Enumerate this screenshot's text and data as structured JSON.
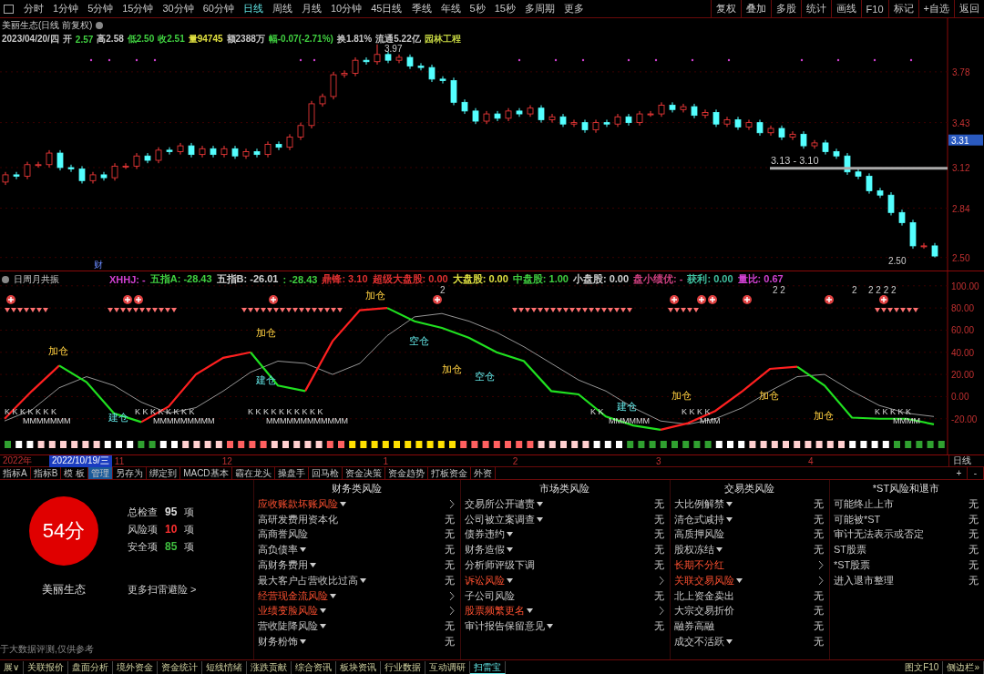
{
  "toolbar": {
    "periods": [
      {
        "label": "分时",
        "selected": false
      },
      {
        "label": "1分钟",
        "selected": false
      },
      {
        "label": "5分钟",
        "selected": false
      },
      {
        "label": "15分钟",
        "selected": false
      },
      {
        "label": "30分钟",
        "selected": false
      },
      {
        "label": "60分钟",
        "selected": false
      },
      {
        "label": "日线",
        "selected": true
      },
      {
        "label": "周线",
        "selected": false
      },
      {
        "label": "月线",
        "selected": false
      },
      {
        "label": "10分钟",
        "selected": false
      },
      {
        "label": "45日线",
        "selected": false
      },
      {
        "label": "季线",
        "selected": false
      },
      {
        "label": "年线",
        "selected": false
      },
      {
        "label": "5秒",
        "selected": false
      },
      {
        "label": "15秒",
        "selected": false
      },
      {
        "label": "多周期",
        "selected": false
      },
      {
        "label": "更多",
        "selected": false
      }
    ],
    "tools": [
      "复权",
      "叠加",
      "多股",
      "统计",
      "画线",
      "F10",
      "标记",
      "+自选",
      "返回"
    ]
  },
  "price_chart": {
    "title": "美丽生态(日线 前复权)",
    "quote": [
      {
        "text": "2023/04/20/四",
        "color": "#c8c8c8"
      },
      {
        "text": "开",
        "color": "#c8c8c8"
      },
      {
        "text": "2.57",
        "color": "#40d040"
      },
      {
        "text": "高2.58",
        "color": "#c8c8c8"
      },
      {
        "text": "低2.50",
        "color": "#40d040"
      },
      {
        "text": "收2.51",
        "color": "#40d040"
      },
      {
        "text": "量94745",
        "color": "#e0e040"
      },
      {
        "text": "额2388万",
        "color": "#c8c8c8"
      },
      {
        "text": "幅-0.07(-2.71%)",
        "color": "#40d040"
      },
      {
        "text": "换1.81%",
        "color": "#c8c8c8"
      },
      {
        "text": "流通5.22亿",
        "color": "#c8c8c8"
      },
      {
        "text": "园林工程",
        "color": "#c0d040"
      }
    ],
    "chart_data": {
      "type": "candlestick",
      "grid": true,
      "ylim": [
        2.41,
        4.15
      ],
      "yticks": [
        {
          "value": 3.78,
          "label": "3.78"
        },
        {
          "value": 3.43,
          "label": "3.43"
        },
        {
          "value": 3.12,
          "label": "3.12"
        },
        {
          "value": 2.84,
          "label": "2.84"
        },
        {
          "value": 2.5,
          "label": "2.50"
        }
      ],
      "ohlc": [
        [
          3.02,
          3.09,
          3.0,
          3.07
        ],
        [
          3.07,
          3.09,
          3.04,
          3.06
        ],
        [
          3.06,
          3.16,
          3.04,
          3.14
        ],
        [
          3.14,
          3.16,
          3.12,
          3.14
        ],
        [
          3.14,
          3.24,
          3.12,
          3.22
        ],
        [
          3.22,
          3.24,
          3.1,
          3.12
        ],
        [
          3.12,
          3.14,
          3.09,
          3.11
        ],
        [
          3.11,
          3.13,
          3.01,
          3.03
        ],
        [
          3.03,
          3.09,
          3.01,
          3.07
        ],
        [
          3.07,
          3.09,
          3.03,
          3.05
        ],
        [
          3.05,
          3.15,
          3.03,
          3.13
        ],
        [
          3.13,
          3.15,
          3.11,
          3.13
        ],
        [
          3.13,
          3.22,
          3.11,
          3.2
        ],
        [
          3.2,
          3.22,
          3.15,
          3.17
        ],
        [
          3.17,
          3.26,
          3.15,
          3.24
        ],
        [
          3.24,
          3.26,
          3.21,
          3.23
        ],
        [
          3.23,
          3.29,
          3.21,
          3.27
        ],
        [
          3.27,
          3.29,
          3.19,
          3.21
        ],
        [
          3.21,
          3.27,
          3.19,
          3.25
        ],
        [
          3.25,
          3.27,
          3.19,
          3.21
        ],
        [
          3.21,
          3.27,
          3.19,
          3.25
        ],
        [
          3.25,
          3.27,
          3.18,
          3.2
        ],
        [
          3.2,
          3.25,
          3.18,
          3.23
        ],
        [
          3.23,
          3.25,
          3.19,
          3.21
        ],
        [
          3.21,
          3.3,
          3.19,
          3.28
        ],
        [
          3.28,
          3.3,
          3.24,
          3.26
        ],
        [
          3.26,
          3.35,
          3.24,
          3.33
        ],
        [
          3.33,
          3.43,
          3.31,
          3.41
        ],
        [
          3.41,
          3.58,
          3.39,
          3.56
        ],
        [
          3.56,
          3.63,
          3.54,
          3.61
        ],
        [
          3.61,
          3.78,
          3.59,
          3.76
        ],
        [
          3.76,
          3.79,
          3.74,
          3.77
        ],
        [
          3.77,
          3.88,
          3.75,
          3.86
        ],
        [
          3.86,
          3.88,
          3.83,
          3.85
        ],
        [
          3.85,
          3.97,
          3.83,
          3.9
        ],
        [
          3.9,
          3.92,
          3.84,
          3.86
        ],
        [
          3.86,
          3.9,
          3.84,
          3.88
        ],
        [
          3.88,
          3.9,
          3.8,
          3.82
        ],
        [
          3.82,
          3.84,
          3.79,
          3.81
        ],
        [
          3.81,
          3.83,
          3.71,
          3.73
        ],
        [
          3.73,
          3.75,
          3.7,
          3.72
        ],
        [
          3.72,
          3.74,
          3.55,
          3.57
        ],
        [
          3.57,
          3.59,
          3.49,
          3.51
        ],
        [
          3.51,
          3.53,
          3.42,
          3.44
        ],
        [
          3.44,
          3.51,
          3.42,
          3.49
        ],
        [
          3.49,
          3.51,
          3.44,
          3.46
        ],
        [
          3.46,
          3.53,
          3.44,
          3.51
        ],
        [
          3.51,
          3.53,
          3.47,
          3.49
        ],
        [
          3.49,
          3.55,
          3.47,
          3.53
        ],
        [
          3.53,
          3.55,
          3.43,
          3.45
        ],
        [
          3.45,
          3.49,
          3.43,
          3.47
        ],
        [
          3.47,
          3.49,
          3.4,
          3.42
        ],
        [
          3.42,
          3.45,
          3.4,
          3.43
        ],
        [
          3.43,
          3.45,
          3.36,
          3.38
        ],
        [
          3.38,
          3.45,
          3.36,
          3.43
        ],
        [
          3.43,
          3.45,
          3.4,
          3.42
        ],
        [
          3.42,
          3.49,
          3.4,
          3.47
        ],
        [
          3.47,
          3.49,
          3.41,
          3.43
        ],
        [
          3.43,
          3.51,
          3.41,
          3.49
        ],
        [
          3.49,
          3.51,
          3.47,
          3.49
        ],
        [
          3.49,
          3.57,
          3.47,
          3.55
        ],
        [
          3.55,
          3.57,
          3.5,
          3.52
        ],
        [
          3.52,
          3.56,
          3.5,
          3.54
        ],
        [
          3.54,
          3.56,
          3.46,
          3.48
        ],
        [
          3.48,
          3.52,
          3.46,
          3.5
        ],
        [
          3.5,
          3.52,
          3.4,
          3.42
        ],
        [
          3.42,
          3.47,
          3.4,
          3.45
        ],
        [
          3.45,
          3.47,
          3.38,
          3.4
        ],
        [
          3.4,
          3.45,
          3.38,
          3.43
        ],
        [
          3.43,
          3.45,
          3.34,
          3.36
        ],
        [
          3.36,
          3.41,
          3.34,
          3.39
        ],
        [
          3.39,
          3.41,
          3.31,
          3.33
        ],
        [
          3.33,
          3.37,
          3.31,
          3.35
        ],
        [
          3.35,
          3.37,
          3.25,
          3.27
        ],
        [
          3.27,
          3.31,
          3.25,
          3.29
        ],
        [
          3.29,
          3.31,
          3.21,
          3.23
        ],
        [
          3.23,
          3.25,
          3.18,
          3.2
        ],
        [
          3.2,
          3.22,
          3.07,
          3.09
        ],
        [
          3.09,
          3.11,
          3.04,
          3.06
        ],
        [
          3.06,
          3.08,
          2.94,
          2.96
        ],
        [
          2.96,
          2.98,
          2.91,
          2.93
        ],
        [
          2.93,
          2.95,
          2.79,
          2.81
        ],
        [
          2.81,
          2.83,
          2.72,
          2.74
        ],
        [
          2.74,
          2.76,
          2.56,
          2.58
        ],
        [
          2.58,
          2.6,
          2.56,
          2.58
        ],
        [
          2.58,
          2.6,
          2.5,
          2.51
        ]
      ]
    },
    "high_label": "3.97",
    "range_label": "3.13 - 3.10",
    "low_label": "2.50",
    "current_price": "3.31",
    "event_marker": "财"
  },
  "indicator": {
    "title": "日周月共振",
    "header_items": [
      {
        "text": "XHHJ: -",
        "color": "#d040d0"
      },
      {
        "text": "五指A: -28.43",
        "color": "#40d040"
      },
      {
        "text": "五指B: -26.01",
        "color": "#d0d0d0"
      },
      {
        "text": ": -28.43",
        "color": "#40d040"
      },
      {
        "text": "鼎锋: 3.10",
        "color": "#e03030"
      },
      {
        "text": "超级大盘股: 0.00",
        "color": "#e03030"
      },
      {
        "text": "大盘股: 0.00",
        "color": "#e0e040"
      },
      {
        "text": "中盘股: 1.00",
        "color": "#40d040"
      },
      {
        "text": "小盘股: 0.00",
        "color": "#d0d0d0"
      },
      {
        "text": "盘小绩优: -",
        "color": "#d04080"
      },
      {
        "text": "获利: 0.00",
        "color": "#40c0a0"
      },
      {
        "text": "量比: 0.67",
        "color": "#d040d0"
      }
    ],
    "chart_data": {
      "type": "line",
      "grid": true,
      "ylim": [
        -35,
        113
      ],
      "yticks": [
        {
          "value": 100,
          "label": "100.00"
        },
        {
          "value": 80,
          "label": "80.00"
        },
        {
          "value": 60,
          "label": "60.00"
        },
        {
          "value": 40,
          "label": "40.00"
        },
        {
          "value": 20,
          "label": "20.00"
        },
        {
          "value": 0,
          "label": "0.00"
        },
        {
          "value": -20,
          "label": "-20.00"
        }
      ],
      "series": [
        {
          "color": "#bbbbbb",
          "values": [
            -22,
            -12,
            8,
            18,
            10,
            -5,
            -15,
            -10,
            5,
            22,
            32,
            30,
            20,
            30,
            55,
            72,
            75,
            68,
            58,
            45,
            30,
            15,
            5,
            -10,
            -22,
            -25,
            -20,
            -10,
            5,
            18,
            20,
            5,
            -8,
            -15,
            -18
          ]
        },
        {
          "color": "#ff2020",
          "values": [
            -20,
            5,
            28,
            null,
            null,
            -23,
            -9,
            20,
            35,
            40,
            null,
            5,
            50,
            78,
            80,
            null,
            null,
            null,
            null,
            null,
            null,
            null,
            null,
            null,
            -30,
            -24,
            -13,
            5,
            25,
            27,
            null,
            null,
            null,
            null,
            null
          ]
        },
        {
          "color": "#20e020",
          "values": [
            null,
            null,
            28,
            13,
            -15,
            -23,
            null,
            null,
            null,
            40,
            10,
            5,
            null,
            null,
            80,
            68,
            62,
            53,
            40,
            32,
            5,
            2,
            -18,
            -26,
            -30,
            null,
            null,
            null,
            null,
            27,
            10,
            -19,
            -20,
            -20,
            -25
          ]
        }
      ]
    },
    "count_labels": [
      "2",
      "2 2",
      "2",
      "2 2 2 2"
    ],
    "signals": [
      {
        "text": "加仓",
        "kind": "add"
      },
      {
        "text": "建仓",
        "kind": "build"
      },
      {
        "text": "加仓",
        "kind": "add"
      },
      {
        "text": "建仓",
        "kind": "build"
      },
      {
        "text": "加仓",
        "kind": "add"
      },
      {
        "text": "空仓",
        "kind": "empty"
      },
      {
        "text": "加仓",
        "kind": "add"
      },
      {
        "text": "空仓",
        "kind": "empty"
      },
      {
        "text": "建仓",
        "kind": "build"
      },
      {
        "text": "加仓",
        "kind": "add"
      },
      {
        "text": "加仓",
        "kind": "add"
      },
      {
        "text": "加仓",
        "kind": "add"
      }
    ],
    "k_rows": [
      {
        "k": "K K K K K K K",
        "m": "MMMMMMM"
      },
      {
        "k": "K K K K K K K K",
        "m": "MMMMMMMMM"
      },
      {
        "k": "K K K K K K K K K K",
        "m": "MMMMMMMMMMMM"
      },
      {
        "k": "K K",
        "m": "MMMMMM"
      },
      {
        "k": "K K K K",
        "m": "MMM"
      },
      {
        "k": "K K K K K",
        "m": "MMMM"
      }
    ]
  },
  "time_axis": {
    "labels": [
      {
        "text": "2022年",
        "selected": false
      },
      {
        "text": "2022/10/19/三",
        "selected": true
      },
      {
        "text": "11",
        "selected": false
      },
      {
        "text": "12",
        "selected": false
      },
      {
        "text": "1",
        "selected": false
      },
      {
        "text": "2",
        "selected": false
      },
      {
        "text": "3",
        "selected": false
      },
      {
        "text": "4",
        "selected": false
      }
    ],
    "period": "日线"
  },
  "indicator_tabs": [
    {
      "label": "指标A",
      "selected": false
    },
    {
      "label": "指标B",
      "selected": false
    },
    {
      "label": "模 板",
      "selected": false
    },
    {
      "label": "管理",
      "selected": true
    },
    {
      "label": "另存为",
      "selected": false
    },
    {
      "label": "绑定到",
      "selected": false
    },
    {
      "label": "MACD基本",
      "selected": false
    },
    {
      "label": "霸在龙头",
      "selected": false
    },
    {
      "label": "操盘手",
      "selected": false
    },
    {
      "label": "回马枪",
      "selected": false
    },
    {
      "label": "资金决策",
      "selected": false
    },
    {
      "label": "资金趋势",
      "selected": false
    },
    {
      "label": "打板资金",
      "selected": false
    },
    {
      "label": "外资",
      "selected": false
    }
  ],
  "zoom_buttons": [
    "+",
    "-"
  ],
  "risk_panel": {
    "score": "54分",
    "stock_name": "美丽生态",
    "stats": [
      {
        "label": "总检查",
        "value": "95",
        "unit": "项",
        "color": "#dddddd"
      },
      {
        "label": "风险项",
        "value": "10",
        "unit": "项",
        "color": "#ff3030"
      },
      {
        "label": "安全项",
        "value": "85",
        "unit": "项",
        "color": "#40c040"
      }
    ],
    "more_link": "更多扫雷避险 >",
    "disclaimer": "于大数据评测,仅供参考",
    "columns": [
      {
        "title": "财务类风险",
        "items": [
          {
            "label": "应收账款坏账风险",
            "dropdown": true,
            "risk": true
          },
          {
            "label": "高研发费用资本化",
            "dropdown": false,
            "risk": false,
            "value": "无"
          },
          {
            "label": "高商誉风险",
            "dropdown": false,
            "risk": false,
            "value": "无"
          },
          {
            "label": "高负债率",
            "dropdown": true,
            "risk": false,
            "value": "无"
          },
          {
            "label": "高财务费用",
            "dropdown": true,
            "risk": false,
            "value": "无"
          },
          {
            "label": "最大客户占营收比过高",
            "dropdown": true,
            "risk": false,
            "value": "无"
          },
          {
            "label": "经营现金流风险",
            "dropdown": true,
            "risk": true
          },
          {
            "label": "业绩变脸风险",
            "dropdown": true,
            "risk": true
          },
          {
            "label": "营收陡降风险",
            "dropdown": true,
            "risk": false,
            "value": "无"
          },
          {
            "label": "财务粉饰",
            "dropdown": true,
            "risk": false,
            "value": "无"
          }
        ]
      },
      {
        "title": "市场类风险",
        "items": [
          {
            "label": "交易所公开谴责",
            "dropdown": true,
            "risk": false,
            "value": "无"
          },
          {
            "label": "公司被立案调查",
            "dropdown": true,
            "risk": false,
            "value": "无"
          },
          {
            "label": "债券违约",
            "dropdown": true,
            "risk": false,
            "value": "无"
          },
          {
            "label": "财务造假",
            "dropdown": true,
            "risk": false,
            "value": "无"
          },
          {
            "label": "分析师评级下调",
            "dropdown": false,
            "risk": false,
            "value": "无"
          },
          {
            "label": "诉讼风险",
            "dropdown": true,
            "risk": true
          },
          {
            "label": "子公司风险",
            "dropdown": false,
            "risk": false,
            "value": "无"
          },
          {
            "label": "股票频繁更名",
            "dropdown": true,
            "risk": true
          },
          {
            "label": "审计报告保留意见",
            "dropdown": true,
            "risk": false,
            "value": "无"
          }
        ]
      },
      {
        "title": "交易类风险",
        "items": [
          {
            "label": "大比例解禁",
            "dropdown": true,
            "risk": false,
            "value": "无"
          },
          {
            "label": "清仓式减持",
            "dropdown": true,
            "risk": false,
            "value": "无"
          },
          {
            "label": "高质押风险",
            "dropdown": false,
            "risk": false,
            "value": "无"
          },
          {
            "label": "股权冻结",
            "dropdown": true,
            "risk": false,
            "value": "无"
          },
          {
            "label": "长期不分红",
            "dropdown": false,
            "risk": true
          },
          {
            "label": "关联交易风险",
            "dropdown": true,
            "risk": true
          },
          {
            "label": "北上资金卖出",
            "dropdown": false,
            "risk": false,
            "value": "无"
          },
          {
            "label": "大宗交易折价",
            "dropdown": false,
            "risk": false,
            "value": "无"
          },
          {
            "label": "融券高融",
            "dropdown": false,
            "risk": false,
            "value": "无"
          },
          {
            "label": "成交不活跃",
            "dropdown": true,
            "risk": false,
            "value": "无"
          }
        ]
      },
      {
        "title": "*ST风险和退市",
        "items": [
          {
            "label": "可能终止上市",
            "dropdown": false,
            "risk": false,
            "value": "无"
          },
          {
            "label": "可能被*ST",
            "dropdown": false,
            "risk": false,
            "value": "无"
          },
          {
            "label": "审计无法表示或否定",
            "dropdown": false,
            "risk": false,
            "value": "无"
          },
          {
            "label": "ST股票",
            "dropdown": false,
            "risk": false,
            "value": "无"
          },
          {
            "label": "*ST股票",
            "dropdown": false,
            "risk": false,
            "value": "无"
          },
          {
            "label": "进入退市整理",
            "dropdown": false,
            "risk": false,
            "value": "无"
          }
        ]
      }
    ]
  },
  "bottom_tabs": [
    {
      "label": "展∨",
      "selected": false
    },
    {
      "label": "关联报价",
      "selected": false
    },
    {
      "label": "盘面分析",
      "selected": false
    },
    {
      "label": "境外资金",
      "selected": false
    },
    {
      "label": "资金统计",
      "selected": false
    },
    {
      "label": "短线情绪",
      "selected": false
    },
    {
      "label": "涨跌贡献",
      "selected": false
    },
    {
      "label": "综合资讯",
      "selected": false
    },
    {
      "label": "板块资讯",
      "selected": false
    },
    {
      "label": "行业数据",
      "selected": false
    },
    {
      "label": "互动调研",
      "selected": false
    },
    {
      "label": "扫雷宝",
      "selected": true
    }
  ],
  "bottom_right": [
    "图文F10",
    "侧边栏»"
  ]
}
